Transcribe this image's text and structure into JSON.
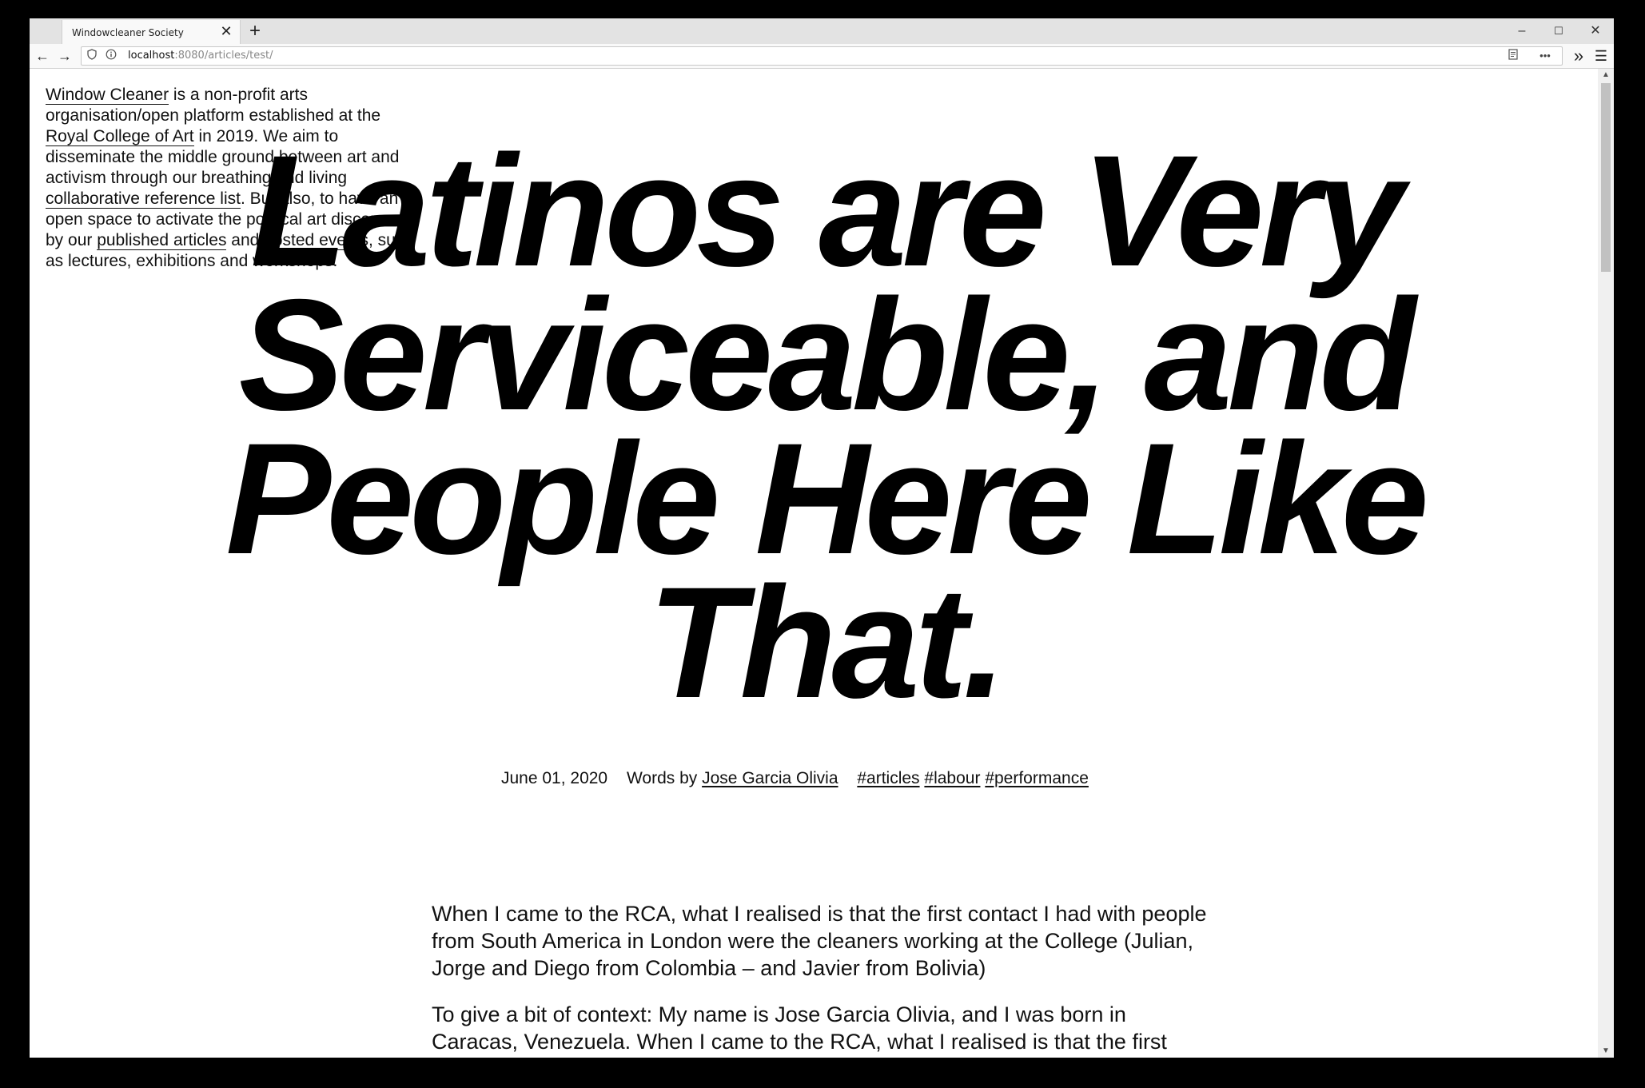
{
  "browser": {
    "tab_title": "Windowcleaner Society",
    "tab_close": "✕",
    "new_tab": "+",
    "minimize": "–",
    "maximize": "☐",
    "close": "✕",
    "back": "←",
    "forward": "→",
    "url_host": "localhost",
    "url_rest": ":8080/articles/test/",
    "reader_icon": "reader-view-icon",
    "more_icon": "•••",
    "overflow": "»",
    "menu": "☰"
  },
  "intro": {
    "link_window_cleaner": "Window Cleaner",
    "text_1": " is a non-profit arts organisation/open platform established at the ",
    "link_rca": "Royal College of Art",
    "text_2": " in 2019. We aim to disseminate the middle ground between art and activism through our breathing and living ",
    "link_reference": "collaborative reference list",
    "text_3": ". But also, to have an open space to activate the political art discourses by our ",
    "link_published": "published articles",
    "text_4": " and ",
    "link_events": "hosted events",
    "text_5": ", such as lectures, exhibitions and workshops."
  },
  "article": {
    "headline": "Latinos are Very Serviceable, and People Here Like That.",
    "date": "June 01, 2020",
    "words_by": "Words by",
    "author": "Jose Garcia Olivia",
    "tags": [
      "#articles",
      "#labour",
      "#performance"
    ],
    "paragraphs": [
      "When I came to the RCA, what I realised is that the first contact I had with people from South America in London were the cleaners working at the College (Julian, Jorge and Diego from Colombia – and Javier from Bolivia)",
      "To give a bit of context: My name is Jose Garcia Olivia, and I was born in Caracas, Venezuela. When I came to the RCA, what I realised is that the first"
    ]
  }
}
